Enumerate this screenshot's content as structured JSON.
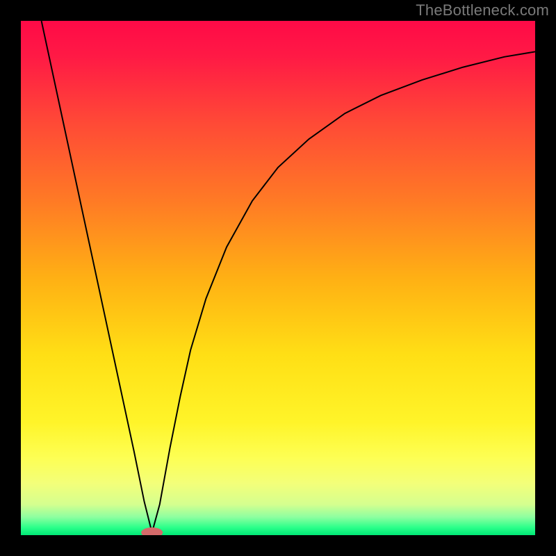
{
  "watermark": "TheBottleneck.com",
  "chart_data": {
    "type": "line",
    "title": "",
    "xlabel": "",
    "ylabel": "",
    "xlim": [
      0,
      100
    ],
    "ylim": [
      0,
      100
    ],
    "grid": false,
    "legend": false,
    "series": [
      {
        "name": "curve",
        "x": [
          4,
          6,
          8,
          10,
          12,
          14,
          16,
          18,
          20,
          22,
          24,
          25.5,
          27,
          29,
          31,
          33,
          36,
          40,
          45,
          50,
          56,
          63,
          70,
          78,
          86,
          94,
          100
        ],
        "y": [
          100,
          90.7,
          81.4,
          72.1,
          62.8,
          53.5,
          44.2,
          34.9,
          25.6,
          16.3,
          6.5,
          0.5,
          6,
          17,
          27,
          36,
          46,
          56,
          65,
          71.5,
          77,
          82,
          85.5,
          88.5,
          91,
          93,
          94
        ]
      }
    ],
    "background_gradient": {
      "type": "vertical",
      "stops": [
        {
          "pos": 0.0,
          "color": "#ff0a47"
        },
        {
          "pos": 0.07,
          "color": "#ff1a45"
        },
        {
          "pos": 0.2,
          "color": "#ff4a36"
        },
        {
          "pos": 0.35,
          "color": "#ff7a25"
        },
        {
          "pos": 0.5,
          "color": "#ffb014"
        },
        {
          "pos": 0.65,
          "color": "#ffdf15"
        },
        {
          "pos": 0.78,
          "color": "#fff429"
        },
        {
          "pos": 0.85,
          "color": "#fdff54"
        },
        {
          "pos": 0.9,
          "color": "#f3ff7a"
        },
        {
          "pos": 0.94,
          "color": "#d5ff8f"
        },
        {
          "pos": 0.965,
          "color": "#8dffa0"
        },
        {
          "pos": 0.985,
          "color": "#2bff8a"
        },
        {
          "pos": 1.0,
          "color": "#00e876"
        }
      ]
    },
    "marker": {
      "x": 25.5,
      "y": 0.5,
      "rx": 2.1,
      "ry": 1.0,
      "color": "#d46a6a"
    },
    "curve_color": "#000000",
    "curve_width": 2
  }
}
